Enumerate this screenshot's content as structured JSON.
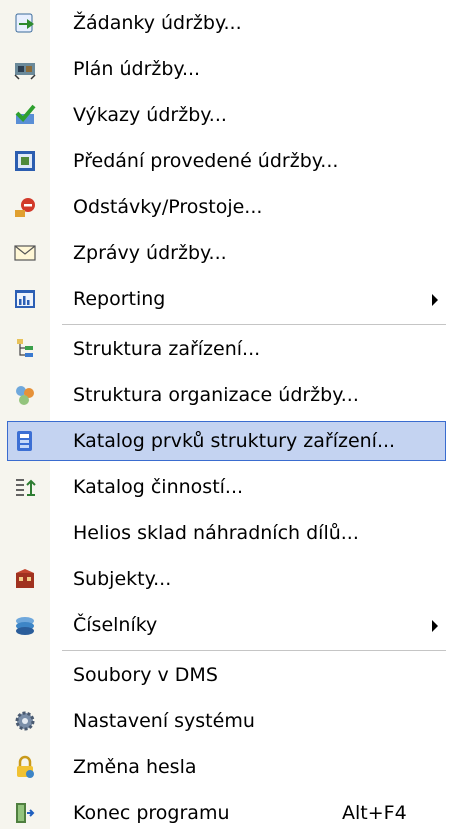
{
  "colors": {
    "gutter": "#f6f5ee",
    "highlight_fill": "#c4d3f1",
    "highlight_border": "#3a6ccf",
    "separator": "#c5c5c5"
  },
  "menu": {
    "items": [
      {
        "label": "Žádanky údržby...",
        "icon": "request-arrow-icon"
      },
      {
        "label": "Plán údržby...",
        "icon": "plan-icon"
      },
      {
        "label": "Výkazy údržby...",
        "icon": "report-check-icon"
      },
      {
        "label": "Předání provedené údržby...",
        "icon": "handover-icon"
      },
      {
        "label": "Odstávky/Prostoje...",
        "icon": "outage-icon"
      },
      {
        "label": "Zprávy údržby...",
        "icon": "envelope-icon"
      },
      {
        "label": "Reporting",
        "icon": "chart-icon",
        "submenu": true
      },
      {
        "label": "Struktura zařízení...",
        "icon": "tree-icon"
      },
      {
        "label": "Struktura organizace údržby...",
        "icon": "organization-icon"
      },
      {
        "label": "Katalog prvků struktury zařízení...",
        "icon": "catalog-icon",
        "highlighted": true
      },
      {
        "label": "Katalog činností...",
        "icon": "activity-icon"
      },
      {
        "label": "Helios sklad náhradních dílů..."
      },
      {
        "label": "Subjekty...",
        "icon": "subjects-icon"
      },
      {
        "label": "Číselníky",
        "icon": "codebook-icon",
        "submenu": true
      },
      {
        "label": "Soubory v DMS"
      },
      {
        "label": "Nastavení systému",
        "icon": "gear-icon"
      },
      {
        "label": "Změna hesla",
        "icon": "lock-icon"
      },
      {
        "label": "Konec programu",
        "icon": "exit-door-icon",
        "shortcut": "Alt+F4"
      }
    ]
  }
}
